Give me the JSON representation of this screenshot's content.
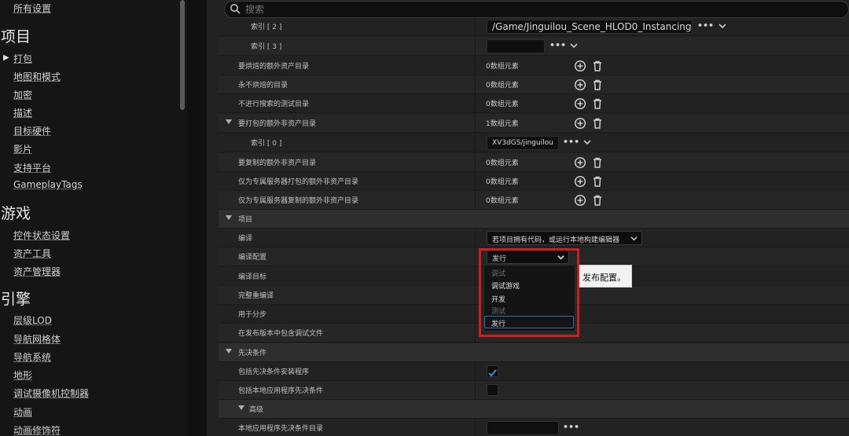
{
  "sidebar": {
    "top_item": "所有设置",
    "categories": [
      "项目",
      "游戏",
      "引擎"
    ],
    "project_items": [
      "打包",
      "地图和模式",
      "加密",
      "描述",
      "目标硬件",
      "影片",
      "支持平台",
      "GameplayTags"
    ],
    "game_items": [
      "控件状态设置",
      "资产工具",
      "资产管理器"
    ],
    "engine_items": [
      "层级LOD",
      "导航网格体",
      "导航系统",
      "地形",
      "调试摄像机控制器",
      "动画",
      "动画修饰符"
    ]
  },
  "search": {
    "placeholder": "搜索"
  },
  "rows": {
    "index2_label": "索引 [ 2 ]",
    "index2_value": "/Game/Jinguilou_Scene_HLOD0_Instancing",
    "index3_label": "索引 [ 3 ]",
    "cook_extra_dirs": {
      "label": "要烘焙的额外资产目录",
      "value": "0数组元素"
    },
    "never_cook_dirs": {
      "label": "永不烘焙的目录",
      "value": "0数组元素"
    },
    "no_search_test_dirs": {
      "label": "不进行搜索的测试目录",
      "value": "0数组元素"
    },
    "package_nonasset_dirs": {
      "label": "要打包的额外非资产目录",
      "value": "1数组元素"
    },
    "index0_label": "索引 [ 0 ]",
    "index0_value": "XV3dGS/jinguilou",
    "copy_nonasset_dirs": {
      "label": "要复制的额外非资产目录",
      "value": "0数组元素"
    },
    "server_package_dirs": {
      "label": "仅为专属服务器打包的额外非资产目录",
      "value": "0数组元素"
    },
    "server_copy_dirs": {
      "label": "仅为专属服务器复制的额外非资产目录",
      "value": "0数组元素"
    },
    "project_section": "项目",
    "build": {
      "label": "编译",
      "value": "若项目拥有代码，或运行本地构建编辑器"
    },
    "build_config": {
      "label": "编译配置",
      "value": "发行"
    },
    "build_target": {
      "label": "编译目标"
    },
    "full_rebuild": {
      "label": "完整重编译"
    },
    "for_distribution": {
      "label": "用于分步"
    },
    "include_debug": {
      "label": "在发布版本中包含调试文件"
    },
    "prereq_section": "先决条件",
    "include_prereq_installer": {
      "label": "包括先决条件安装程序",
      "checked": true
    },
    "include_app_prereqs": {
      "label": "包括本地应用程序先决条件",
      "checked": false
    },
    "advanced_section": "高级",
    "app_prereq_dir": {
      "label": "本地应用程序先决条件目录"
    }
  },
  "dropdown": {
    "items": [
      {
        "text": "调试",
        "kind": "section"
      },
      {
        "text": "调试游戏",
        "kind": "option"
      },
      {
        "text": "开发",
        "kind": "option"
      },
      {
        "text": "测试",
        "kind": "section"
      },
      {
        "text": "发行",
        "kind": "option",
        "selected": true
      }
    ]
  },
  "tooltip": "发布配置。",
  "colors": {
    "highlight": "#d01c1c",
    "selection": "#2f6fb0",
    "check": "#3b8ede"
  }
}
